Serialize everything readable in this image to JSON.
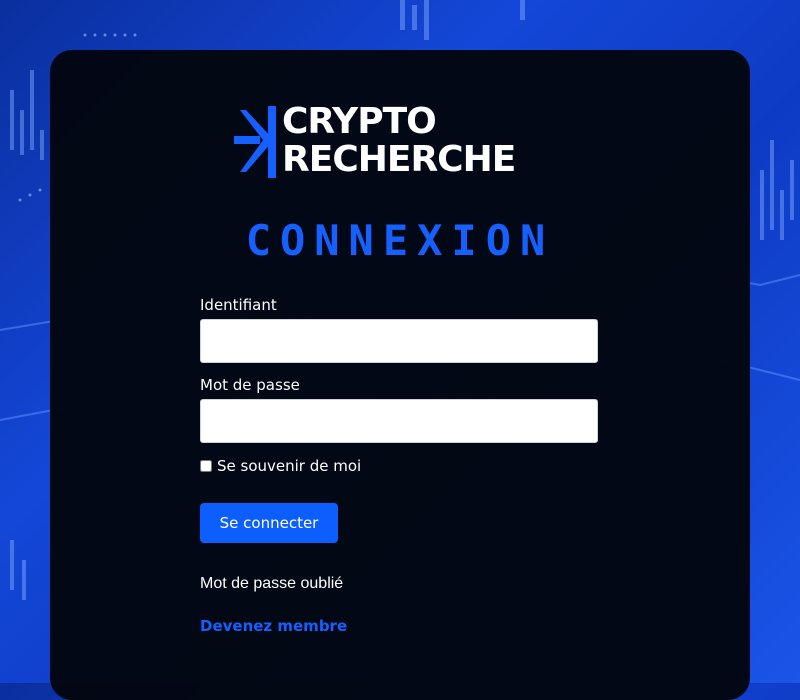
{
  "logo": {
    "line1": "CRYPTO",
    "line2": "RECHERCHE"
  },
  "title": "CONNEXION",
  "form": {
    "username_label": "Identifiant",
    "username_value": "",
    "password_label": "Mot de passe",
    "password_value": "",
    "remember_label": "Se souvenir de moi",
    "remember_checked": false,
    "submit_label": "Se connecter"
  },
  "links": {
    "forgot_password": "Mot de passe oublié",
    "become_member": "Devenez membre"
  },
  "colors": {
    "accent": "#1560ff",
    "card_background": "#03060f",
    "page_background": "#1447d8"
  }
}
